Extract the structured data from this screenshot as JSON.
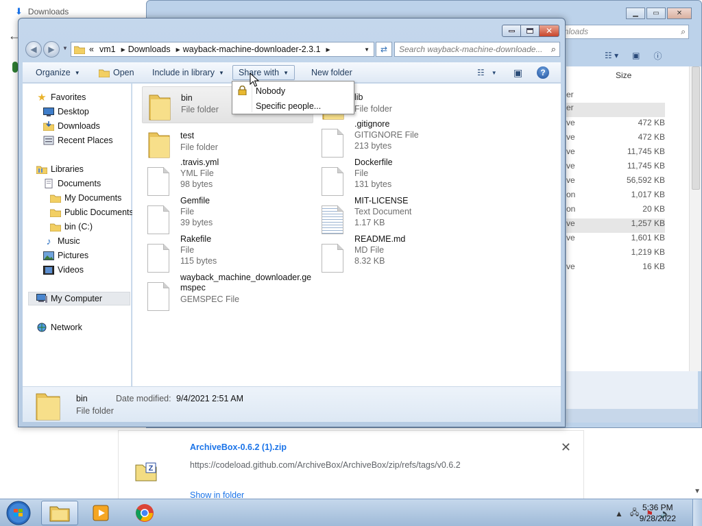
{
  "browser": {
    "tab_title": "Downloads",
    "download": {
      "filename": "ArchiveBox-0.6.2 (1).zip",
      "url": "https://codeload.github.com/ArchiveBox/ArchiveBox/zip/refs/tags/v0.6.2",
      "show_in_folder": "Show in folder",
      "close": "✕"
    }
  },
  "explorer_back": {
    "search_placeholder": "wnloads",
    "size_header": "Size",
    "rows": [
      {
        "type": "er",
        "size": ""
      },
      {
        "type": "er",
        "size": ""
      },
      {
        "type": "ve",
        "size": "472 KB"
      },
      {
        "type": "ve",
        "size": "472 KB"
      },
      {
        "type": "ve",
        "size": "11,745 KB"
      },
      {
        "type": "ve",
        "size": "11,745 KB"
      },
      {
        "type": "ve",
        "size": "56,592 KB"
      },
      {
        "type": "on",
        "size": "1,017 KB"
      },
      {
        "type": "on",
        "size": "20 KB"
      },
      {
        "type": "ve",
        "size": "1,257 KB"
      },
      {
        "type": "ve",
        "size": "1,601 KB"
      },
      {
        "type": "",
        "size": "1,219 KB"
      },
      {
        "type": "ve",
        "size": "16 KB"
      }
    ]
  },
  "explorer": {
    "breadcrumb": {
      "overflow": "«",
      "items": [
        "vm1",
        "Downloads",
        "wayback-machine-downloader-2.3.1"
      ]
    },
    "search_placeholder": "Search wayback-machine-downloade...",
    "toolbar": {
      "organize": "Organize",
      "open": "Open",
      "include_in_library": "Include in library",
      "share_with": "Share with",
      "new_folder": "New folder"
    },
    "nav": {
      "favorites": "Favorites",
      "desktop": "Desktop",
      "downloads": "Downloads",
      "recent_places": "Recent Places",
      "libraries": "Libraries",
      "documents": "Documents",
      "my_documents": "My Documents",
      "public_documents": "Public Documents",
      "bin_c": "bin (C:)",
      "music": "Music",
      "pictures": "Pictures",
      "videos": "Videos",
      "my_computer": "My Computer",
      "network": "Network"
    },
    "files": [
      {
        "name": "bin",
        "type": "File folder",
        "size": ""
      },
      {
        "name": "lib",
        "type": "File folder",
        "size": ""
      },
      {
        "name": "test",
        "type": "File folder",
        "size": ""
      },
      {
        "name": ".gitignore",
        "type": "GITIGNORE File",
        "size": "213 bytes"
      },
      {
        "name": ".travis.yml",
        "type": "YML File",
        "size": "98 bytes"
      },
      {
        "name": "Dockerfile",
        "type": "File",
        "size": "131 bytes"
      },
      {
        "name": "Gemfile",
        "type": "File",
        "size": "39 bytes"
      },
      {
        "name": "MIT-LICENSE",
        "type": "Text Document",
        "size": "1.17 KB"
      },
      {
        "name": "Rakefile",
        "type": "File",
        "size": "115 bytes"
      },
      {
        "name": "README.md",
        "type": "MD File",
        "size": "8.32 KB"
      },
      {
        "name": "wayback_machine_downloader.ge",
        "name2": "mspec",
        "type": "GEMSPEC File",
        "size": ""
      }
    ],
    "details": {
      "name": "bin",
      "date_label": "Date modified:",
      "date_value": "9/4/2021 2:51 AM",
      "type": "File folder"
    },
    "share_menu": {
      "nobody": "Nobody",
      "specific_people": "Specific people..."
    }
  },
  "taskbar": {
    "time": "5:36 PM",
    "date": "9/28/2022"
  },
  "colors": {
    "link_blue": "#1a73e8",
    "window_frame": "#c4d7ec",
    "close_red": "#c8452b"
  }
}
